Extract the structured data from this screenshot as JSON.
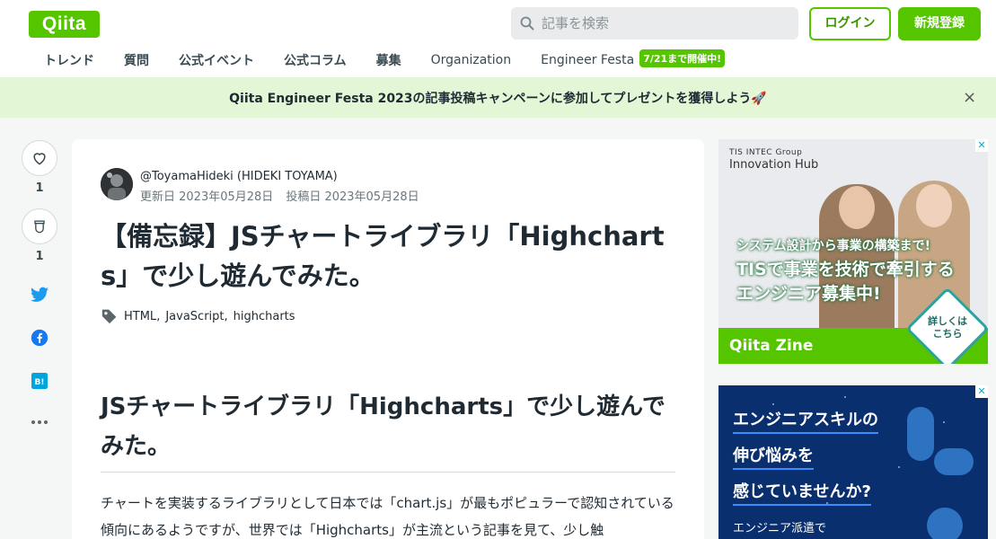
{
  "header": {
    "logo_text": "Qiita",
    "search_placeholder": "記事を検索",
    "login_label": "ログイン",
    "signup_label": "新規登録",
    "nav": [
      "トレンド",
      "質問",
      "公式イベント",
      "公式コラム",
      "募集",
      "Organization",
      "Engineer Festa"
    ],
    "festa_badge": "7/21まで開催中!"
  },
  "banner": {
    "text": "Qiita Engineer Festa 2023の記事投稿キャンペーンに参加してプレゼントを獲得しよう🚀",
    "close": "×"
  },
  "rail": {
    "like_count": "1",
    "stock_count": "1"
  },
  "article": {
    "author": "@ToyamaHideki (HIDEKI TOYAMA)",
    "updated": "更新日 2023年05月28日",
    "posted": "投稿日 2023年05月28日",
    "title": "【備忘録】JSチャートライブラリ「Highcharts」で少し遊んでみた。",
    "tags": [
      "HTML",
      "JavaScript",
      "highcharts"
    ],
    "h2": "JSチャートライブラリ「Highcharts」で少し遊んでみた。",
    "paragraph": "チャートを実装するライブラリとして日本では「chart.js」が最もポピュラーで認知されている傾向にあるようですが、世界では「Highcharts」が主流という記事を見て、少し触"
  },
  "ad1": {
    "label": "TIS INTEC Group",
    "hub": "Innovation Hub",
    "line1": "システム設計から事業の構築まで!",
    "line2": "TISで事業を技術で牽引する",
    "line3": "エンジニア募集中!",
    "cta1": "詳しくは",
    "cta2": "こちら",
    "zine": "Qiita Zine"
  },
  "ad2": {
    "line1": "エンジニアスキルの",
    "line2": "伸び悩みを",
    "line3": "感じていませんか?",
    "small": "エンジニア派遣で"
  }
}
